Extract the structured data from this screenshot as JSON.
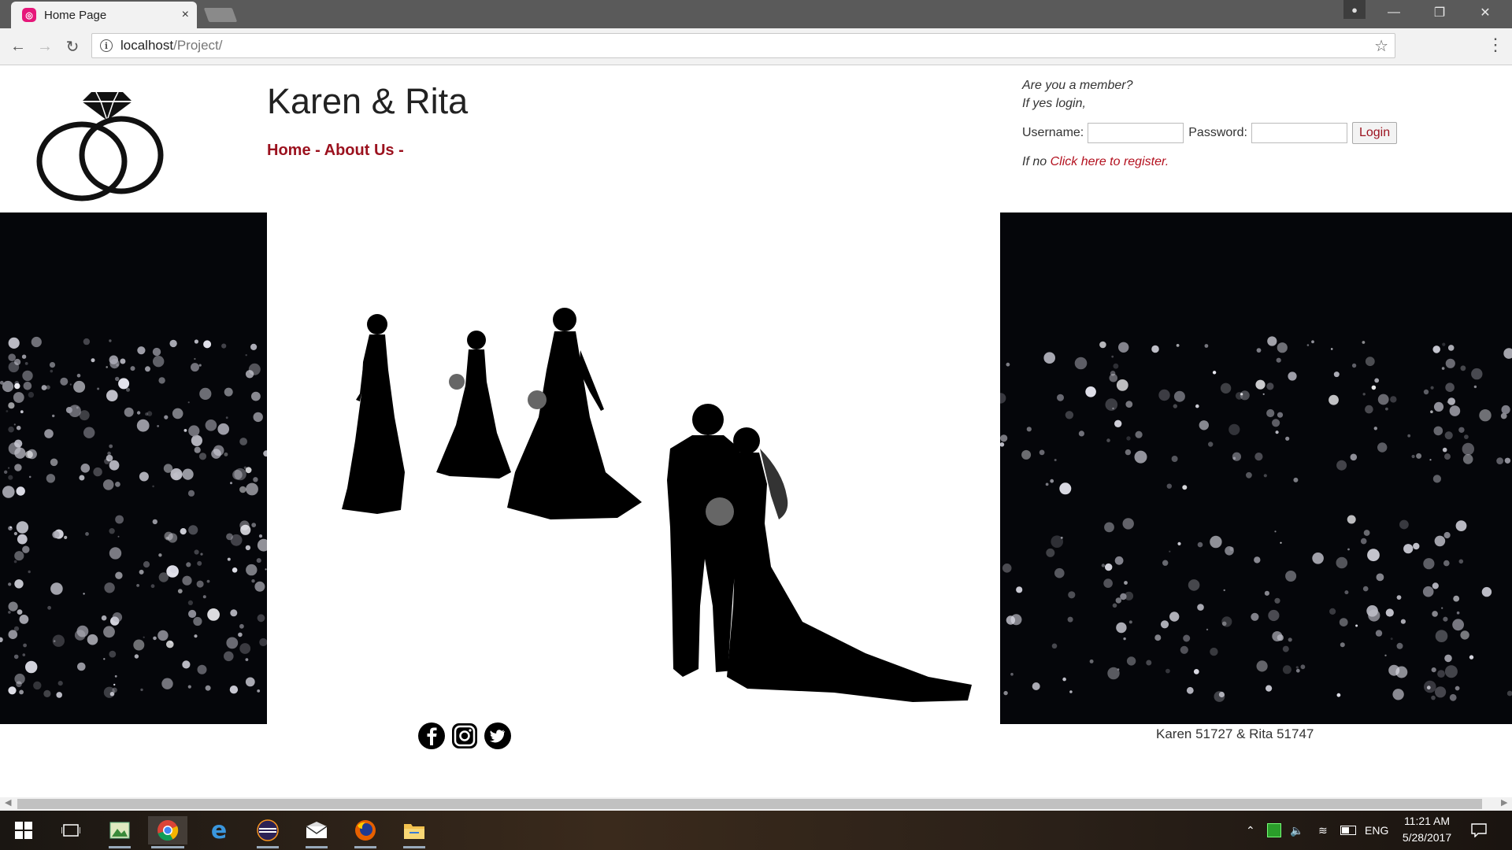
{
  "browser": {
    "tab_title": "Home Page",
    "tab_close": "×",
    "url_host": "localhost",
    "url_path": "/Project/",
    "window_controls": [
      "minimize-icon",
      "restore-icon",
      "close-icon"
    ]
  },
  "site": {
    "title": "Karen & Rita",
    "nav": [
      {
        "label": "Home"
      },
      {
        "label": "About Us"
      }
    ],
    "nav_separator": "-"
  },
  "login": {
    "question": "Are you a member?",
    "prompt": "If yes login,",
    "username_label": "Username:",
    "password_label": "Password:",
    "username_value": "",
    "password_value": "",
    "login_button": "Login",
    "register_prefix": "If no ",
    "register_link": "Click here to register."
  },
  "footer": {
    "social": [
      "facebook-icon",
      "instagram-icon",
      "twitter-icon"
    ],
    "credits": "Karen 51727 & Rita 51747"
  },
  "taskbar": {
    "apps": [
      "start-icon",
      "task-view-icon",
      "gallery-app-icon",
      "chrome-icon",
      "edge-icon",
      "eclipse-icon",
      "mail-icon",
      "firefox-icon",
      "file-explorer-icon"
    ],
    "language": "ENG",
    "time": "11:21 AM",
    "date": "5/28/2017"
  },
  "colors": {
    "nav_link": "#9b111e",
    "tabstrip": "#5a5a5a",
    "banner_side": "#05060a"
  }
}
